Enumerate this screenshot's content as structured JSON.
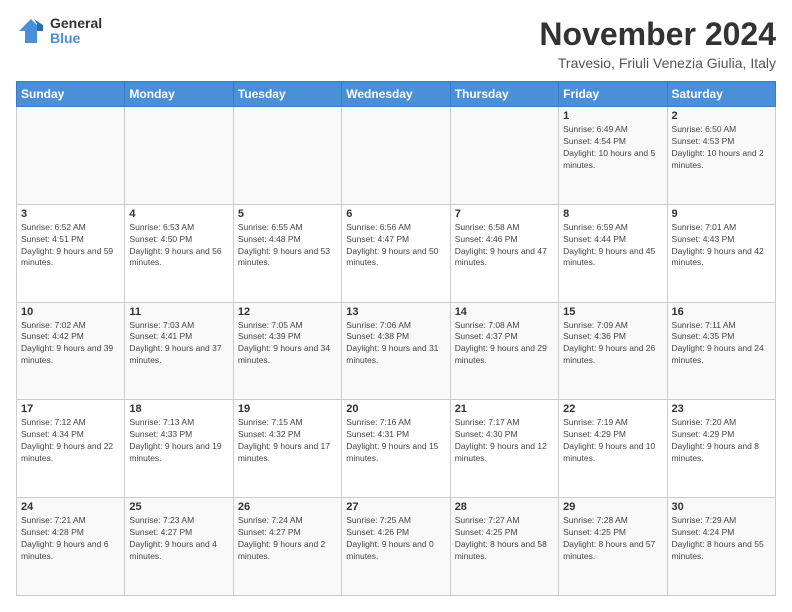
{
  "logo": {
    "line1": "General",
    "line2": "Blue"
  },
  "title": "November 2024",
  "location": "Travesio, Friuli Venezia Giulia, Italy",
  "weekdays": [
    "Sunday",
    "Monday",
    "Tuesday",
    "Wednesday",
    "Thursday",
    "Friday",
    "Saturday"
  ],
  "weeks": [
    [
      {
        "day": "",
        "info": ""
      },
      {
        "day": "",
        "info": ""
      },
      {
        "day": "",
        "info": ""
      },
      {
        "day": "",
        "info": ""
      },
      {
        "day": "",
        "info": ""
      },
      {
        "day": "1",
        "info": "Sunrise: 6:49 AM\nSunset: 4:54 PM\nDaylight: 10 hours and 5 minutes."
      },
      {
        "day": "2",
        "info": "Sunrise: 6:50 AM\nSunset: 4:53 PM\nDaylight: 10 hours and 2 minutes."
      }
    ],
    [
      {
        "day": "3",
        "info": "Sunrise: 6:52 AM\nSunset: 4:51 PM\nDaylight: 9 hours and 59 minutes."
      },
      {
        "day": "4",
        "info": "Sunrise: 6:53 AM\nSunset: 4:50 PM\nDaylight: 9 hours and 56 minutes."
      },
      {
        "day": "5",
        "info": "Sunrise: 6:55 AM\nSunset: 4:48 PM\nDaylight: 9 hours and 53 minutes."
      },
      {
        "day": "6",
        "info": "Sunrise: 6:56 AM\nSunset: 4:47 PM\nDaylight: 9 hours and 50 minutes."
      },
      {
        "day": "7",
        "info": "Sunrise: 6:58 AM\nSunset: 4:46 PM\nDaylight: 9 hours and 47 minutes."
      },
      {
        "day": "8",
        "info": "Sunrise: 6:59 AM\nSunset: 4:44 PM\nDaylight: 9 hours and 45 minutes."
      },
      {
        "day": "9",
        "info": "Sunrise: 7:01 AM\nSunset: 4:43 PM\nDaylight: 9 hours and 42 minutes."
      }
    ],
    [
      {
        "day": "10",
        "info": "Sunrise: 7:02 AM\nSunset: 4:42 PM\nDaylight: 9 hours and 39 minutes."
      },
      {
        "day": "11",
        "info": "Sunrise: 7:03 AM\nSunset: 4:41 PM\nDaylight: 9 hours and 37 minutes."
      },
      {
        "day": "12",
        "info": "Sunrise: 7:05 AM\nSunset: 4:39 PM\nDaylight: 9 hours and 34 minutes."
      },
      {
        "day": "13",
        "info": "Sunrise: 7:06 AM\nSunset: 4:38 PM\nDaylight: 9 hours and 31 minutes."
      },
      {
        "day": "14",
        "info": "Sunrise: 7:08 AM\nSunset: 4:37 PM\nDaylight: 9 hours and 29 minutes."
      },
      {
        "day": "15",
        "info": "Sunrise: 7:09 AM\nSunset: 4:36 PM\nDaylight: 9 hours and 26 minutes."
      },
      {
        "day": "16",
        "info": "Sunrise: 7:11 AM\nSunset: 4:35 PM\nDaylight: 9 hours and 24 minutes."
      }
    ],
    [
      {
        "day": "17",
        "info": "Sunrise: 7:12 AM\nSunset: 4:34 PM\nDaylight: 9 hours and 22 minutes."
      },
      {
        "day": "18",
        "info": "Sunrise: 7:13 AM\nSunset: 4:33 PM\nDaylight: 9 hours and 19 minutes."
      },
      {
        "day": "19",
        "info": "Sunrise: 7:15 AM\nSunset: 4:32 PM\nDaylight: 9 hours and 17 minutes."
      },
      {
        "day": "20",
        "info": "Sunrise: 7:16 AM\nSunset: 4:31 PM\nDaylight: 9 hours and 15 minutes."
      },
      {
        "day": "21",
        "info": "Sunrise: 7:17 AM\nSunset: 4:30 PM\nDaylight: 9 hours and 12 minutes."
      },
      {
        "day": "22",
        "info": "Sunrise: 7:19 AM\nSunset: 4:29 PM\nDaylight: 9 hours and 10 minutes."
      },
      {
        "day": "23",
        "info": "Sunrise: 7:20 AM\nSunset: 4:29 PM\nDaylight: 9 hours and 8 minutes."
      }
    ],
    [
      {
        "day": "24",
        "info": "Sunrise: 7:21 AM\nSunset: 4:28 PM\nDaylight: 9 hours and 6 minutes."
      },
      {
        "day": "25",
        "info": "Sunrise: 7:23 AM\nSunset: 4:27 PM\nDaylight: 9 hours and 4 minutes."
      },
      {
        "day": "26",
        "info": "Sunrise: 7:24 AM\nSunset: 4:27 PM\nDaylight: 9 hours and 2 minutes."
      },
      {
        "day": "27",
        "info": "Sunrise: 7:25 AM\nSunset: 4:26 PM\nDaylight: 9 hours and 0 minutes."
      },
      {
        "day": "28",
        "info": "Sunrise: 7:27 AM\nSunset: 4:25 PM\nDaylight: 8 hours and 58 minutes."
      },
      {
        "day": "29",
        "info": "Sunrise: 7:28 AM\nSunset: 4:25 PM\nDaylight: 8 hours and 57 minutes."
      },
      {
        "day": "30",
        "info": "Sunrise: 7:29 AM\nSunset: 4:24 PM\nDaylight: 8 hours and 55 minutes."
      }
    ]
  ]
}
